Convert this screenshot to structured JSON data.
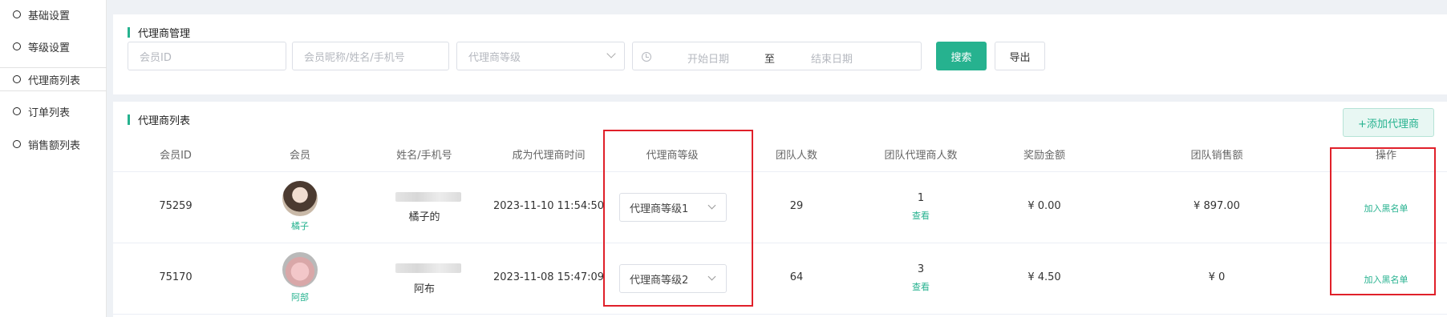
{
  "sidebar": {
    "items": [
      {
        "label": "基础设置"
      },
      {
        "label": "等级设置"
      },
      {
        "label": "代理商列表"
      },
      {
        "label": "订单列表"
      },
      {
        "label": "销售额列表"
      }
    ]
  },
  "search": {
    "title": "代理商管理",
    "member_id_placeholder": "会员ID",
    "name_placeholder": "会员昵称/姓名/手机号",
    "level_placeholder": "代理商等级",
    "start_date_placeholder": "开始日期",
    "range_separator": "至",
    "end_date_placeholder": "结束日期",
    "search_button": "搜索",
    "export_button": "导出"
  },
  "list": {
    "title": "代理商列表",
    "add_button": "+添加代理商",
    "columns": [
      "会员ID",
      "会员",
      "姓名/手机号",
      "成为代理商时间",
      "代理商等级",
      "团队人数",
      "团队代理商人数",
      "奖励金额",
      "团队销售额",
      "操作"
    ],
    "rows": [
      {
        "member_id": "75259",
        "nickname": "橘子",
        "name": "橘子的",
        "joined": "2023-11-10 11:54:50",
        "level": "代理商等级1",
        "team_size": "29",
        "team_agents": "1",
        "view": "查看",
        "reward": "¥ 0.00",
        "team_sales": "¥ 897.00",
        "action": "加入黑名单"
      },
      {
        "member_id": "75170",
        "nickname": "阿部",
        "name": "阿布",
        "joined": "2023-11-08 15:47:09",
        "level": "代理商等级2",
        "team_size": "64",
        "team_agents": "3",
        "view": "查看",
        "reward": "¥ 4.50",
        "team_sales": "¥ 0",
        "action": "加入黑名单"
      }
    ]
  },
  "colors": {
    "accent": "#26b28f",
    "highlight_box": "#e0202a"
  }
}
